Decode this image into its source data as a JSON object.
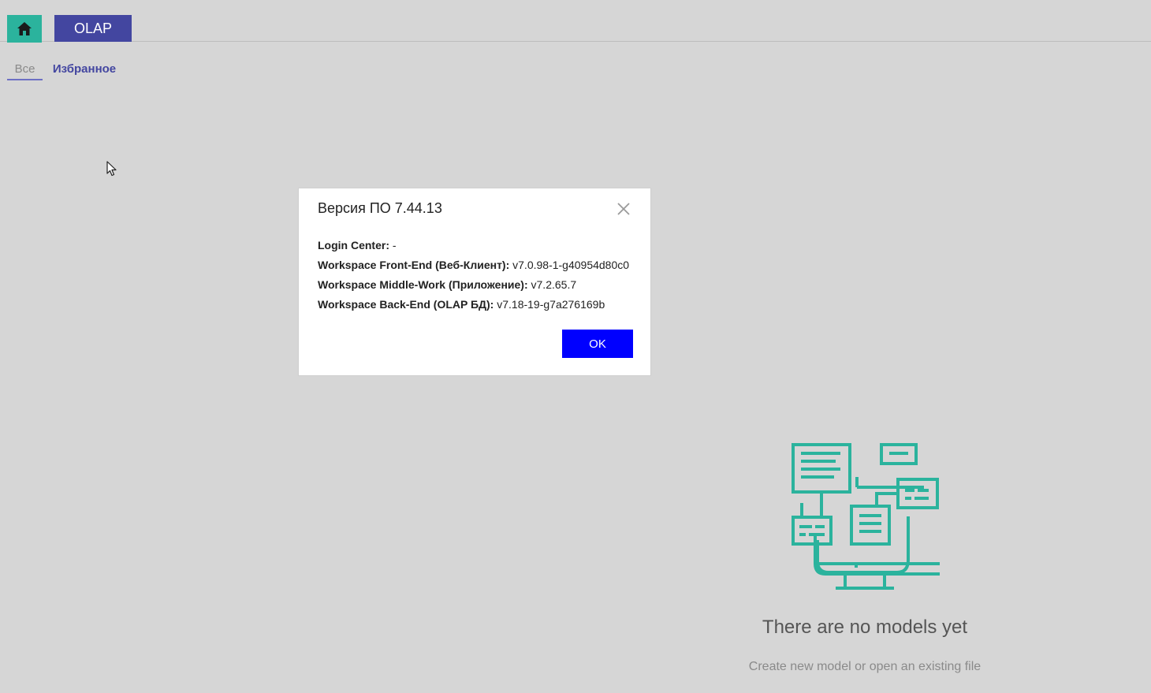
{
  "header": {
    "home_icon": "home-icon",
    "tab_label": "OLAP",
    "accent_color": "#4346a0",
    "home_color": "#2bb39d"
  },
  "subtabs": {
    "all_label": "Все",
    "favorites_label": "Избранное",
    "active": "all"
  },
  "empty_state": {
    "illustration": "monitor-with-windows-icon",
    "title": "There are no models yet",
    "subtitle": "Create new model or open an existing file",
    "illustration_color": "#2bb39d"
  },
  "dialog": {
    "title": "Версия ПО 7.44.13",
    "close_icon": "close-icon",
    "lines": [
      {
        "label": "Login Center:",
        "value": "-"
      },
      {
        "label": "Workspace Front-End (Веб-Клиент):",
        "value": "v7.0.98-1-g40954d80c0"
      },
      {
        "label": "Workspace Middle-Work (Приложение):",
        "value": "v7.2.65.7"
      },
      {
        "label": "Workspace Back-End (OLAP БД):",
        "value": "v7.18-19-g7a276169b"
      }
    ],
    "ok_label": "OK",
    "ok_color": "#0000ff"
  }
}
